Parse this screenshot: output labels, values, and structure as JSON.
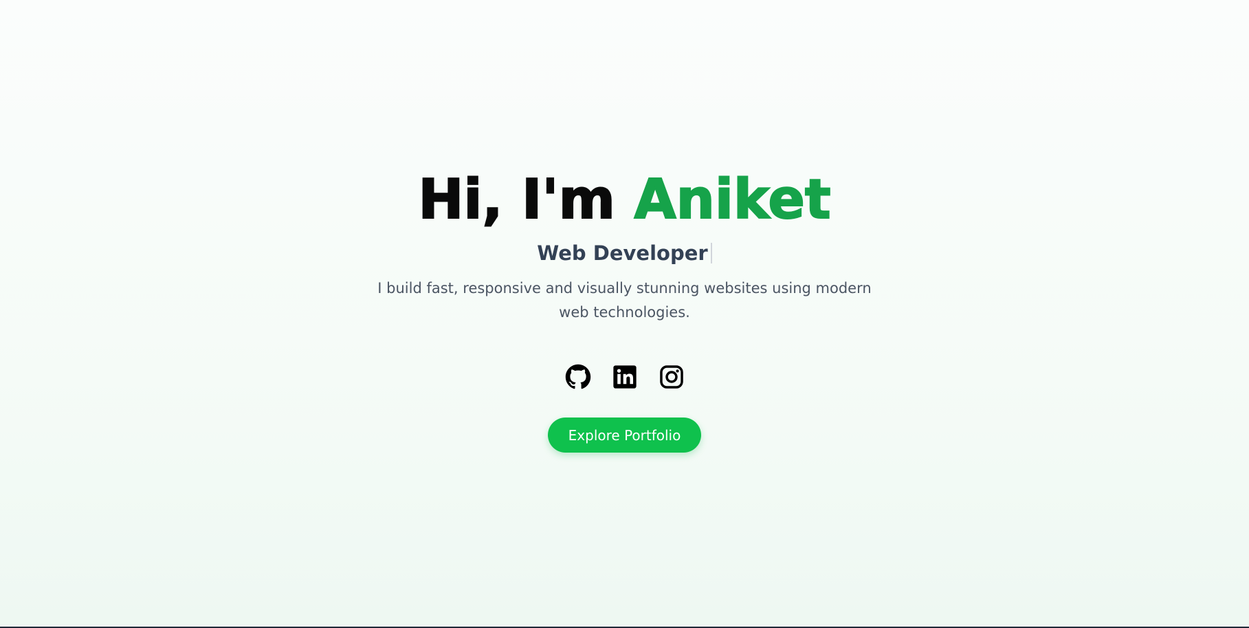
{
  "hero": {
    "greeting": "Hi, I'm",
    "name": "Aniket",
    "role": "Web Developer",
    "tagline": "I build fast, responsive and visually stunning websites using modern web technologies.",
    "cta_label": "Explore Portfolio"
  },
  "socials": [
    {
      "icon": "github-icon"
    },
    {
      "icon": "linkedin-icon"
    },
    {
      "icon": "instagram-icon"
    }
  ],
  "colors": {
    "accent": "#16a34a",
    "button": "#0fc14d",
    "heading": "#0a0a0a",
    "role": "#334155",
    "tagline": "#4b5563"
  }
}
